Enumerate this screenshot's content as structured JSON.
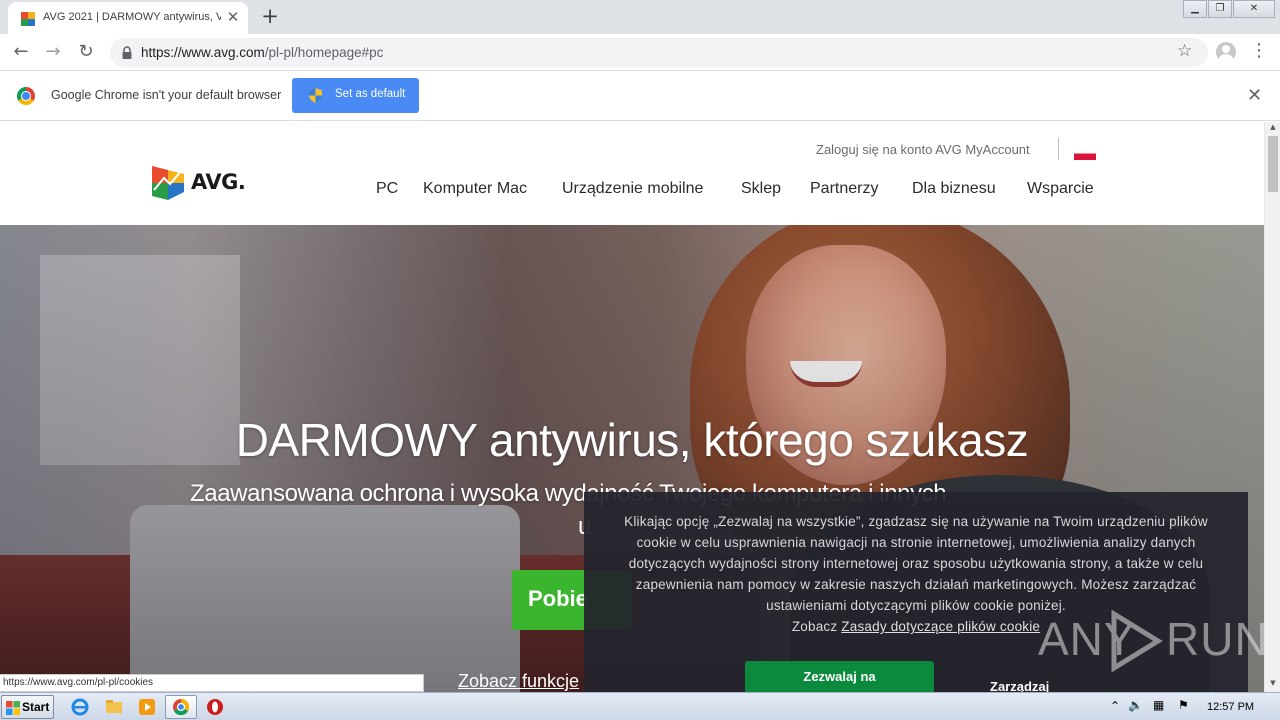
{
  "browser": {
    "tab_title": "AVG 2021 | DARMOWY antywirus, Vi",
    "url_host": "https://www.avg.com",
    "url_path": "/pl-pl/homepage#pc",
    "infobar_text": "Google Chrome isn't your default browser",
    "set_default_label": "Set as default"
  },
  "header": {
    "myaccount_link": "Zaloguj się na konto AVG MyAccount",
    "logo_text": "AVG.",
    "nav": [
      "PC",
      "Komputer Mac",
      "Urządzenie mobilne",
      "Sklep",
      "Partnerzy",
      "Dla biznesu",
      "Wsparcie"
    ]
  },
  "hero": {
    "title": "DARMOWY antywirus, którego szukasz",
    "subtitle_line1": "Zaawansowana ochrona i wysoka wydajność Twojego komputera i innych",
    "subtitle_line2": "u",
    "download_label": "Pobie",
    "features_link": "Zobacz funkcje"
  },
  "cookie": {
    "text": "Klikając opcję „Zezwalaj na wszystkie”, zgadzasz się na używanie na Twoim urządzeniu plików cookie w celu usprawnienia nawigacji na stronie internetowej, umożliwienia analizy danych dotyczących wydajności strony internetowej oraz sposobu użytkowania strony, a także w celu zapewnienia nam pomocy w zakresie naszych działań marketingowych. Możesz zarządzać ustawieniami dotyczącymi plików cookie poniżej.",
    "see_prefix": "Zobacz",
    "policy_link": "Zasady dotyczące plików cookie",
    "allow_label": "Zezwalaj na",
    "manage_label": "Zarządzaj"
  },
  "watermark": {
    "left": "ANY",
    "right": "RUN"
  },
  "status_bar_url": "https://www.avg.com/pl-pl/cookies",
  "taskbar": {
    "start_label": "Start",
    "clock": "12:57 PM"
  },
  "colors": {
    "download_green": "#3cb52e",
    "allow_green": "#0b8a3e",
    "chrome_blue_button": "#4a8af4"
  }
}
